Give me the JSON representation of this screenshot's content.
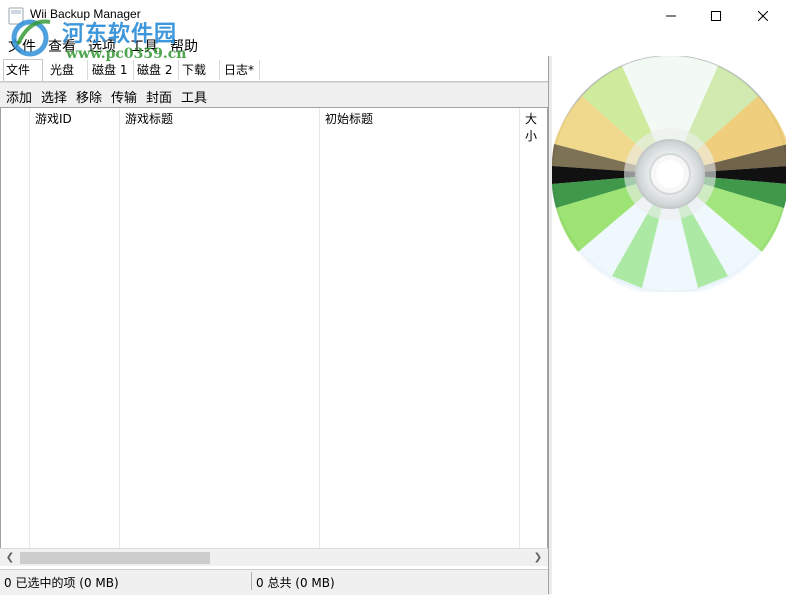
{
  "window": {
    "title": "Wii Backup Manager"
  },
  "watermark": {
    "brand": "河东软件园",
    "url": "www.pc0359.cn"
  },
  "menu": [
    {
      "label": "文件"
    },
    {
      "label": "查看"
    },
    {
      "label": "选项"
    },
    {
      "label": "工具"
    },
    {
      "label": "帮助"
    }
  ],
  "tabs": [
    {
      "label": "文件"
    },
    {
      "label": "光盘"
    },
    {
      "label": "磁盘 1"
    },
    {
      "label": "磁盘 2"
    },
    {
      "label": "下载"
    },
    {
      "label": "日志*"
    }
  ],
  "toolbar": [
    {
      "label": "添加"
    },
    {
      "label": "选择"
    },
    {
      "label": "移除"
    },
    {
      "label": "传输"
    },
    {
      "label": "封面"
    },
    {
      "label": "工具"
    }
  ],
  "columns": [
    {
      "label": ""
    },
    {
      "label": "游戏ID"
    },
    {
      "label": "游戏标题"
    },
    {
      "label": "初始标题"
    },
    {
      "label": "大小"
    }
  ],
  "status": {
    "selected": "0 已选中的项 (0 MB)",
    "total": "0 总共 (0 MB)"
  },
  "colors": {
    "watermark_blue": "#2f8fd8",
    "watermark_green": "#3a9c3a"
  }
}
